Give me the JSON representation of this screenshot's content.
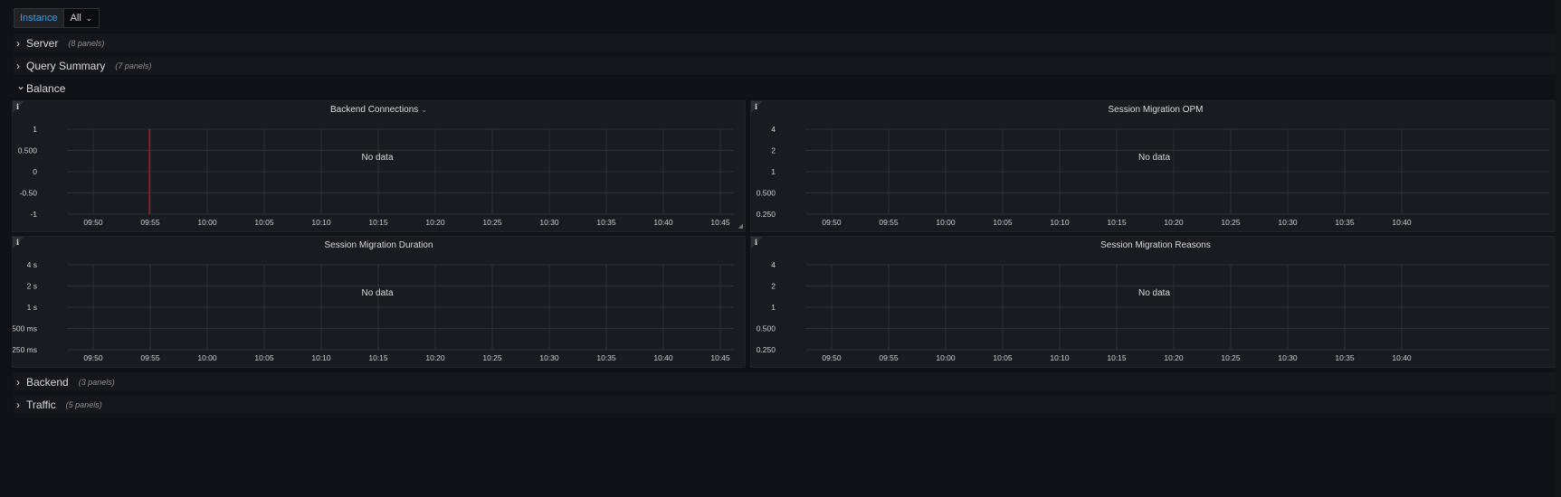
{
  "variables": {
    "label": "Instance",
    "value": "All",
    "dropdown_icon": "chevron-down-icon"
  },
  "rows": [
    {
      "title": "Server",
      "count": "(8 panels)",
      "expanded": false
    },
    {
      "title": "Query Summary",
      "count": "(7 panels)",
      "expanded": false
    },
    {
      "title": "Balance",
      "count": "",
      "expanded": true
    },
    {
      "title": "Backend",
      "count": "(3 panels)",
      "expanded": false
    },
    {
      "title": "Traffic",
      "count": "(5 panels)",
      "expanded": false
    }
  ],
  "icons": {
    "collapsed": "chevron-right-icon",
    "expanded": "chevron-down-icon",
    "info": "info-icon"
  },
  "colors": {
    "background": "#111217",
    "panel": "#181b1f",
    "grid": "#2c3235",
    "link": "#33a2e5",
    "annotation": "#c4162a"
  },
  "panels": [
    {
      "title": "Backend Connections",
      "has_menu_caret": true,
      "no_data_text": "No data",
      "y_ticks": [
        "1",
        "0.500",
        "0",
        "-0.50",
        "-1"
      ],
      "x_ticks": [
        "09:50",
        "09:55",
        "10:00",
        "10:05",
        "10:10",
        "10:15",
        "10:20",
        "10:25",
        "10:30",
        "10:35",
        "10:40",
        "10:45"
      ],
      "annotation_time": "09:55"
    },
    {
      "title": "Session Migration OPM",
      "has_menu_caret": false,
      "no_data_text": "No data",
      "y_ticks": [
        "4",
        "2",
        "1",
        "0.500",
        "0.250"
      ],
      "x_ticks": [
        "09:50",
        "09:55",
        "10:00",
        "10:05",
        "10:10",
        "10:15",
        "10:20",
        "10:25",
        "10:30",
        "10:35",
        "10:40"
      ]
    },
    {
      "title": "Session Migration Duration",
      "has_menu_caret": false,
      "no_data_text": "No data",
      "y_ticks": [
        "4 s",
        "2 s",
        "1 s",
        "500 ms",
        "250 ms"
      ],
      "x_ticks": [
        "09:50",
        "09:55",
        "10:00",
        "10:05",
        "10:10",
        "10:15",
        "10:20",
        "10:25",
        "10:30",
        "10:35",
        "10:40",
        "10:45"
      ]
    },
    {
      "title": "Session Migration Reasons",
      "has_menu_caret": false,
      "no_data_text": "No data",
      "y_ticks": [
        "4",
        "2",
        "1",
        "0.500",
        "0.250"
      ],
      "x_ticks": [
        "09:50",
        "09:55",
        "10:00",
        "10:05",
        "10:10",
        "10:15",
        "10:20",
        "10:25",
        "10:30",
        "10:35",
        "10:40"
      ]
    }
  ]
}
